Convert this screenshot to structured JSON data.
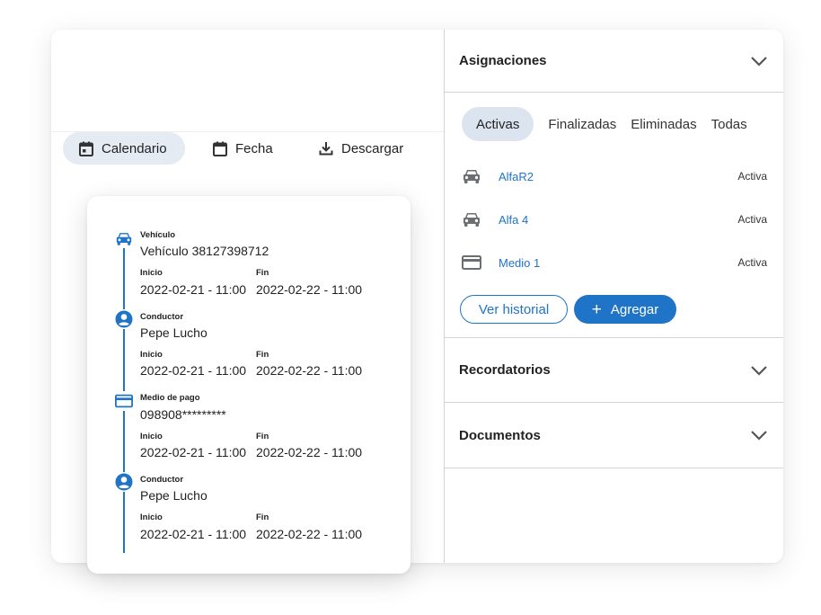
{
  "toolbar": {
    "calendar_label": "Calendario",
    "date_label": "Fecha",
    "download_label": "Descargar"
  },
  "timeline": {
    "items": [
      {
        "label": "Vehículo",
        "value": "Vehículo 38127398712",
        "start_label": "Inicio",
        "end_label": "Fin",
        "start": "2022-02-21 - 11:00",
        "end": "2022-02-22 - 11:00",
        "icon": "car-icon"
      },
      {
        "label": "Conductor",
        "value": "Pepe Lucho",
        "start_label": "Inicio",
        "end_label": "Fin",
        "start": "2022-02-21 - 11:00",
        "end": "2022-02-22 - 11:00",
        "icon": "person-icon"
      },
      {
        "label": "Medio de pago",
        "value": "098908*********",
        "start_label": "Inicio",
        "end_label": "Fin",
        "start": "2022-02-21 - 11:00",
        "end": "2022-02-22 - 11:00",
        "icon": "credit-card-icon"
      },
      {
        "label": "Conductor",
        "value": "Pepe Lucho",
        "start_label": "Inicio",
        "end_label": "Fin",
        "start": "2022-02-21 - 11:00",
        "end": "2022-02-22 - 11:00",
        "icon": "person-icon"
      }
    ]
  },
  "assignments": {
    "title": "Asignaciones",
    "tabs": [
      "Activas",
      "Finalizadas",
      "Eliminadas",
      "Todas"
    ],
    "active_tab": "Activas",
    "rows": [
      {
        "name": "AlfaR2",
        "status": "Activa",
        "icon": "car-icon"
      },
      {
        "name": "Alfa 4",
        "status": "Activa",
        "icon": "car-icon"
      },
      {
        "name": "Medio 1",
        "status": "Activa",
        "icon": "credit-card-icon"
      }
    ],
    "history_button": "Ver historial",
    "add_button": "Agregar"
  },
  "reminders": {
    "title": "Recordatorios"
  },
  "documents": {
    "title": "Documentos"
  },
  "colors": {
    "accent": "#1f74c7",
    "tab_active_bg": "#dce5ef",
    "icon_gray": "#6b6f74",
    "divider": "#d4d4d4"
  }
}
